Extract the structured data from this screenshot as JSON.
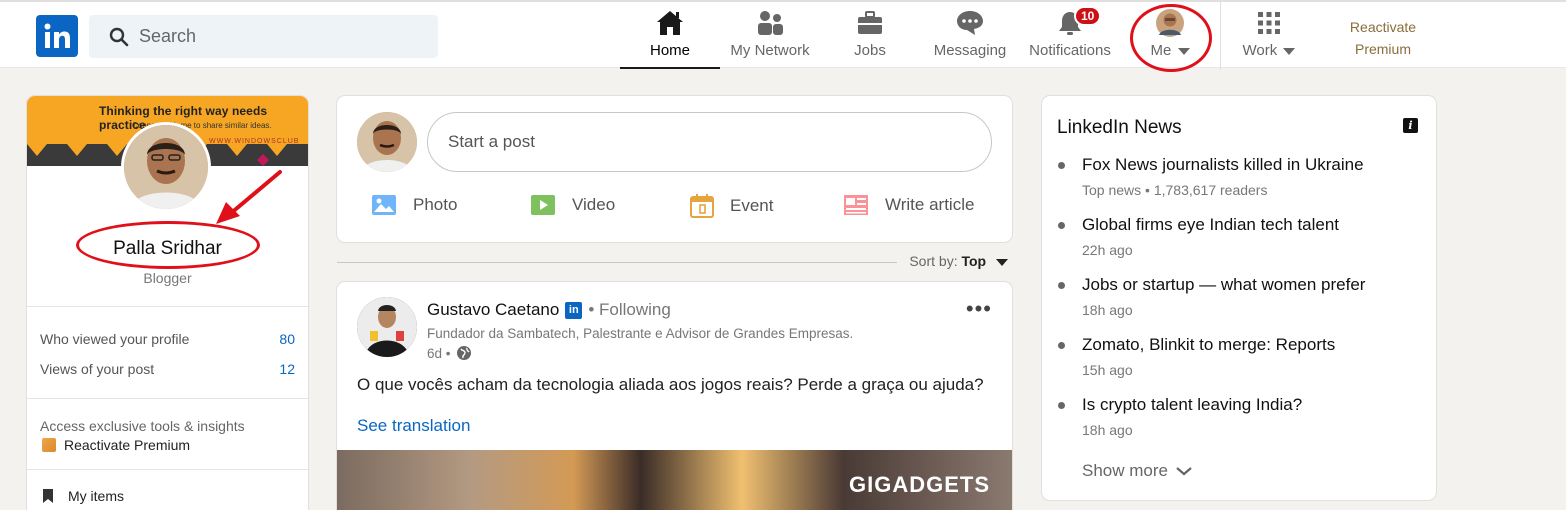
{
  "nav": {
    "search_placeholder": "Search",
    "items": [
      {
        "label": "Home",
        "icon": "home-icon"
      },
      {
        "label": "My Network",
        "icon": "network-icon"
      },
      {
        "label": "Jobs",
        "icon": "briefcase-icon"
      },
      {
        "label": "Messaging",
        "icon": "chat-icon"
      },
      {
        "label": "Notifications",
        "icon": "bell-icon",
        "badge": "10"
      },
      {
        "label": "Me",
        "icon": "avatar"
      },
      {
        "label": "Work",
        "icon": "grid-icon"
      }
    ],
    "premium": [
      "Reactivate",
      "Premium"
    ]
  },
  "profile": {
    "banner_text": "Thinking the right way needs practice.",
    "banner_sub": "Connect with me to share similar ideas.",
    "banner_url": "WWW.WINDOWSCLUB",
    "name": "Palla Sridhar",
    "title": "Blogger",
    "stats": [
      {
        "label": "Who viewed your profile",
        "value": "80"
      },
      {
        "label": "Views of your post",
        "value": "12"
      }
    ],
    "access_text": "Access exclusive tools & insights",
    "premium_link": "Reactivate Premium",
    "my_items": "My items"
  },
  "composer": {
    "placeholder": "Start a post",
    "actions": [
      {
        "label": "Photo",
        "icon": "photo-icon",
        "color": "#70b5f9"
      },
      {
        "label": "Video",
        "icon": "video-icon",
        "color": "#7fc15e"
      },
      {
        "label": "Event",
        "icon": "event-icon",
        "color": "#e7a33e"
      },
      {
        "label": "Write article",
        "icon": "article-icon",
        "color": "#fc9295"
      }
    ]
  },
  "sort": {
    "label": "Sort by:",
    "value": "Top"
  },
  "post": {
    "author": "Gustavo Caetano",
    "connection": "• Following",
    "headline": "Fundador da Sambatech, Palestrante e Advisor de Grandes Empresas.",
    "time": "6d •",
    "body": "O que vocês acham da tecnologia aliada aos jogos reais? Perde a graça ou ajuda?",
    "translate": "See translation",
    "watermark": "GIGADGETS"
  },
  "news": {
    "title": "LinkedIn News",
    "items": [
      {
        "headline": "Fox News journalists killed in Ukraine",
        "sub": "Top news • 1,783,617 readers"
      },
      {
        "headline": "Global firms eye Indian tech talent",
        "sub": "22h ago"
      },
      {
        "headline": "Jobs or startup — what women prefer",
        "sub": "18h ago"
      },
      {
        "headline": "Zomato, Blinkit to merge: Reports",
        "sub": "15h ago"
      },
      {
        "headline": "Is crypto talent leaving India?",
        "sub": "18h ago"
      }
    ],
    "show_more": "Show more"
  },
  "colors": {
    "brand": "#0a66c2",
    "annotation": "#e0101a",
    "premium": "#8a6d3b"
  }
}
